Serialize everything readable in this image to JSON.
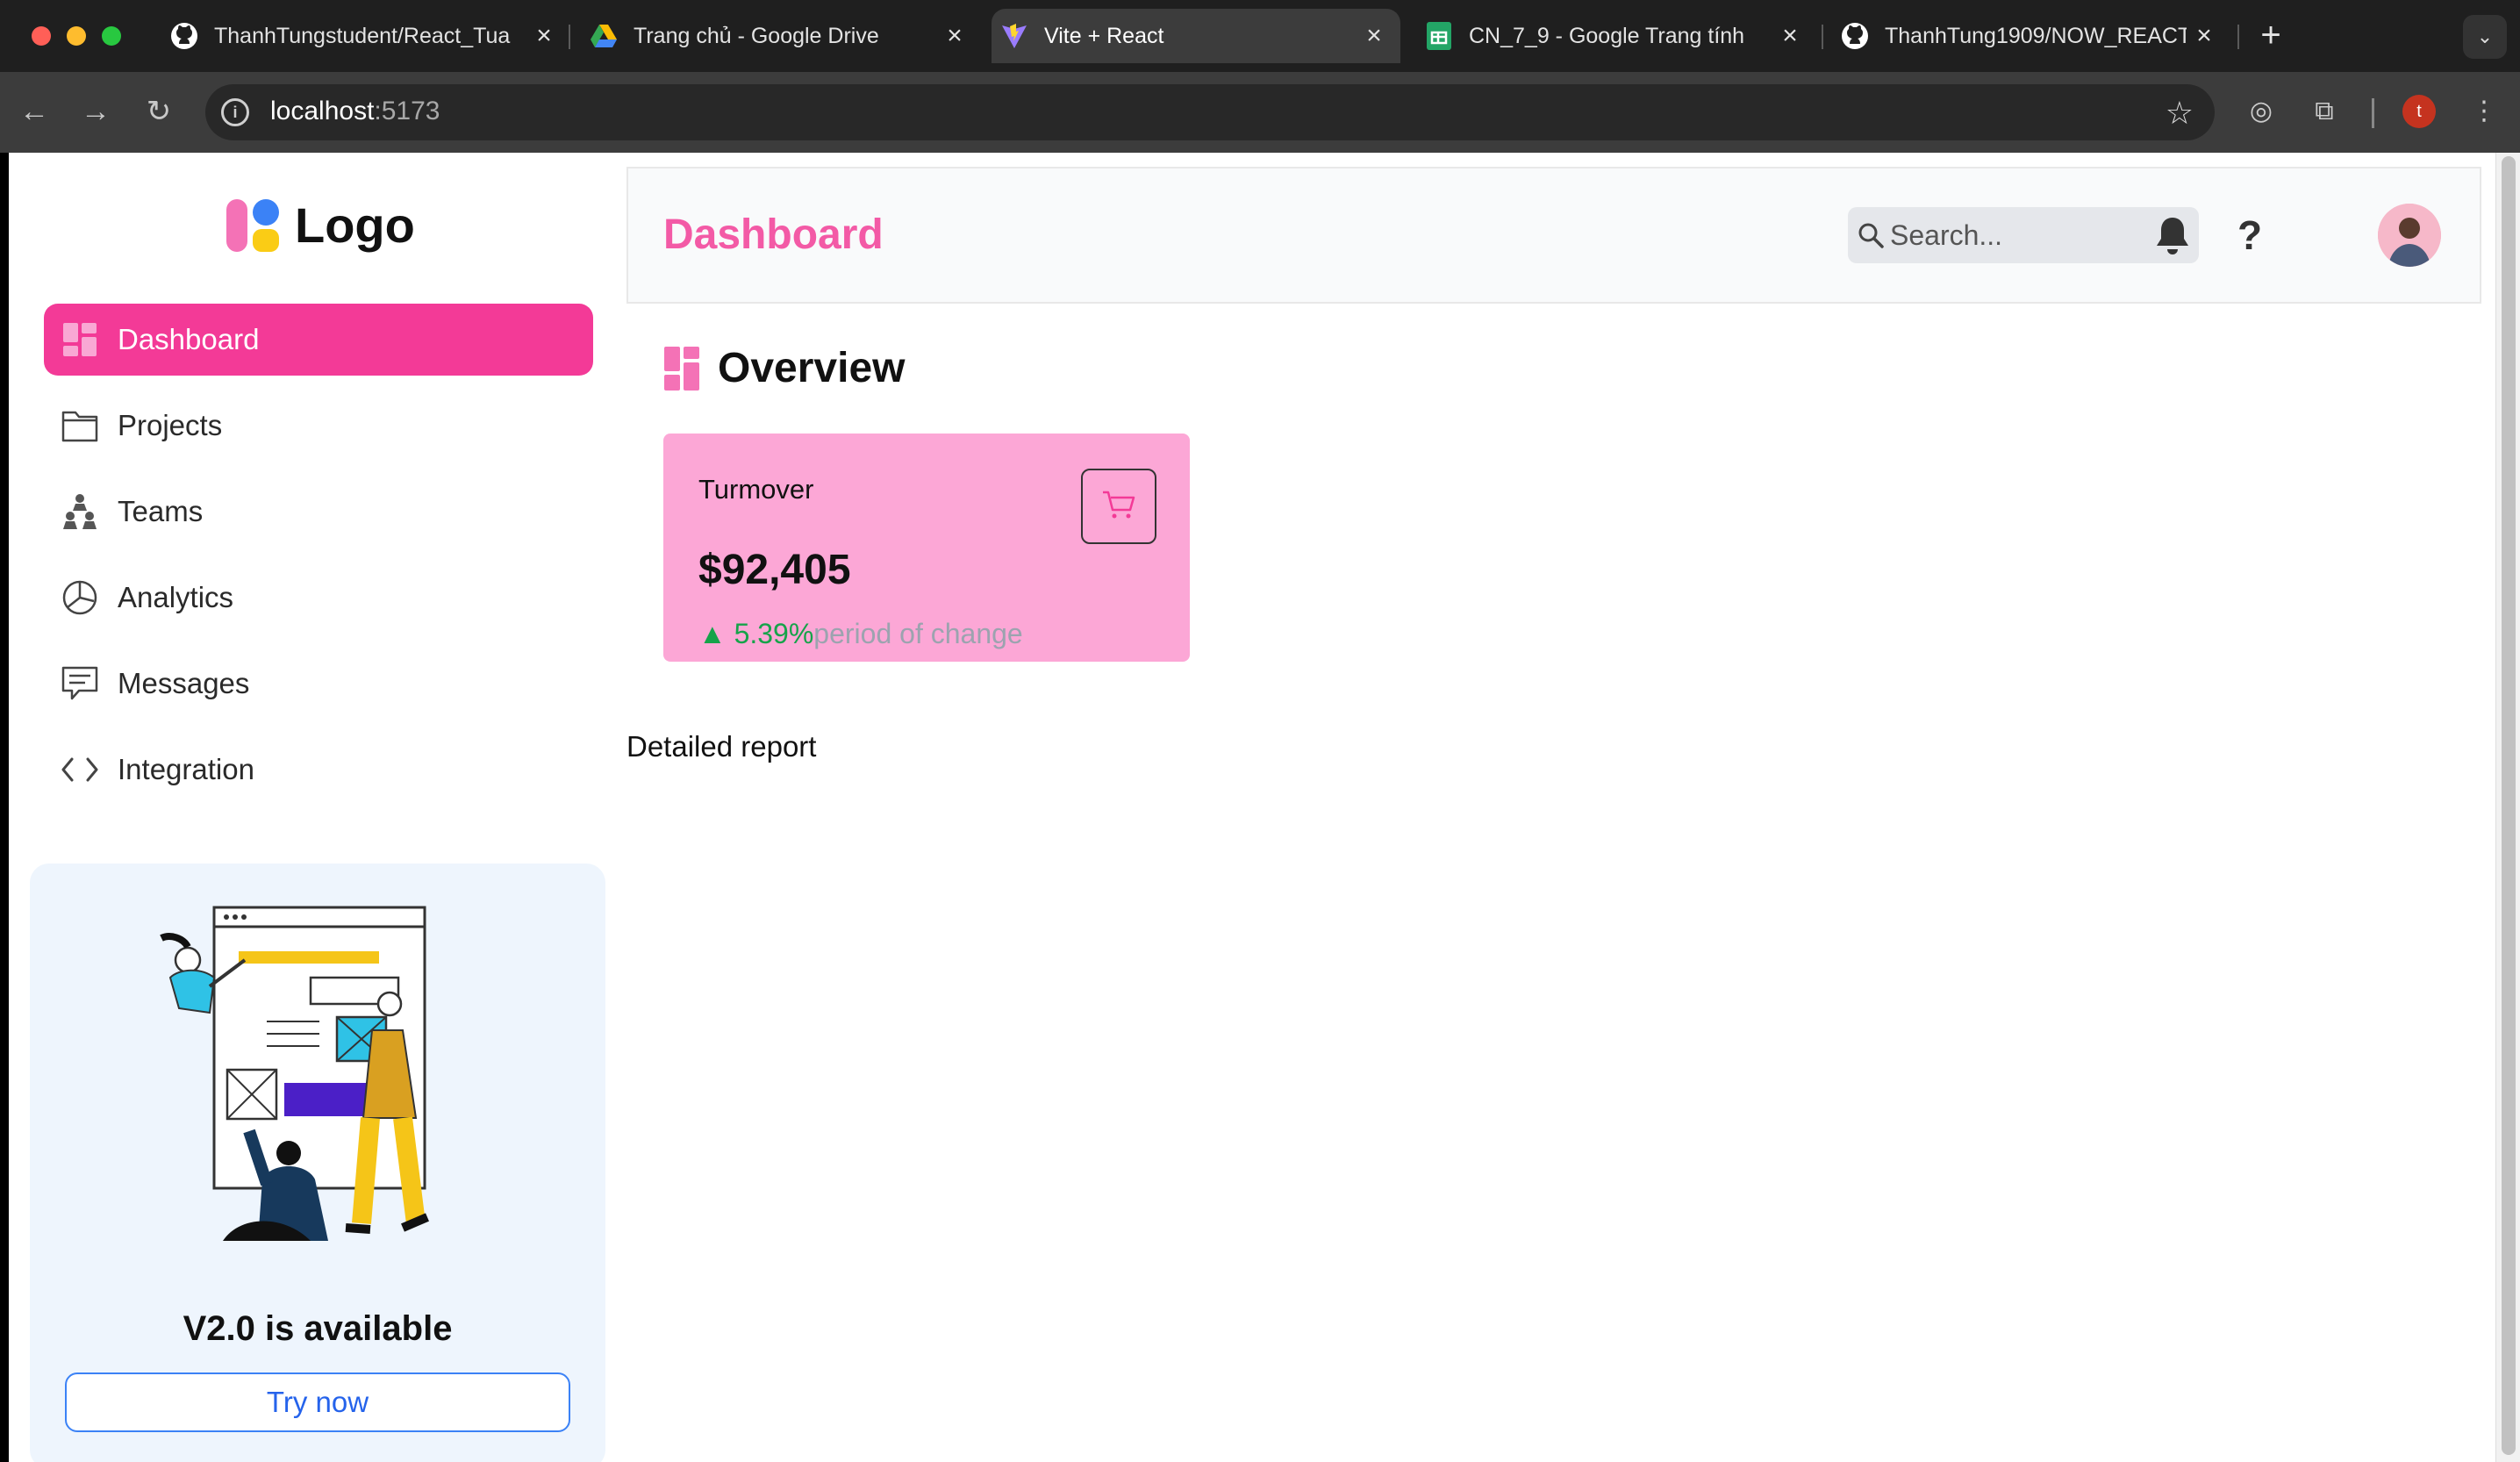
{
  "browser": {
    "tabs": [
      {
        "title": "ThanhTungstudent/React_Tua",
        "icon": "github-icon",
        "active": false
      },
      {
        "title": "Trang chủ - Google Drive",
        "icon": "google-drive-icon",
        "active": false
      },
      {
        "title": "Vite + React",
        "icon": "vite-icon",
        "active": true
      },
      {
        "title": "CN_7_9 - Google Trang tính",
        "icon": "google-sheets-icon",
        "active": false
      },
      {
        "title": "ThanhTung1909/NOW_REACT",
        "icon": "github-icon",
        "active": false
      }
    ],
    "url_host": "localhost",
    "url_port": ":5173",
    "profile_initial": "t"
  },
  "sidebar": {
    "logo_text": "Logo",
    "items": [
      {
        "label": "Dashboard",
        "icon": "dashboard-grid-icon",
        "active": true
      },
      {
        "label": "Projects",
        "icon": "folder-icon",
        "active": false
      },
      {
        "label": "Teams",
        "icon": "teams-icon",
        "active": false
      },
      {
        "label": "Analytics",
        "icon": "pie-chart-icon",
        "active": false
      },
      {
        "label": "Messages",
        "icon": "message-icon",
        "active": false
      },
      {
        "label": "Integration",
        "icon": "code-icon",
        "active": false
      }
    ],
    "promo": {
      "title": "V2.0 is available",
      "button": "Try now"
    }
  },
  "header": {
    "title": "Dashboard",
    "search_placeholder": "Search..."
  },
  "overview": {
    "title": "Overview",
    "card": {
      "label": "Turmover",
      "value": "$92,405",
      "change": "▲ 5.39%",
      "change_note": "period of change"
    }
  },
  "detail_title": "Detailed report",
  "colors": {
    "accent": "#f33a97",
    "title_pink": "#f35aa6",
    "card_bg": "#fca7d6",
    "positive": "#16a34a"
  }
}
